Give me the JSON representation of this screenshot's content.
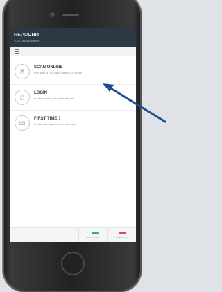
{
  "app": {
    "brand_prefix": "READ",
    "brand_bold": "UNIT",
    "subtitle": "TOOL MANAGEMENT"
  },
  "menu": [
    {
      "title": "SCAN ONLINE",
      "description": "Free scan of QR codes, internet is required",
      "icon": "qr-scan-icon"
    },
    {
      "title": "LOGIN",
      "description": "For full access to all mobile features",
      "icon": "login-icon"
    },
    {
      "title": "FIRST TIME ?",
      "description": "Contact sale department to hear more",
      "icon": "mail-icon"
    }
  ],
  "footer": {
    "server_status_label": "Server status",
    "scanner_label": "© 2018 scanner",
    "server_status_color": "#3fb14e",
    "scanner_color": "#e0434b"
  },
  "colors": {
    "header_bg": "#2c3945",
    "arrow": "#1f4e8c"
  }
}
